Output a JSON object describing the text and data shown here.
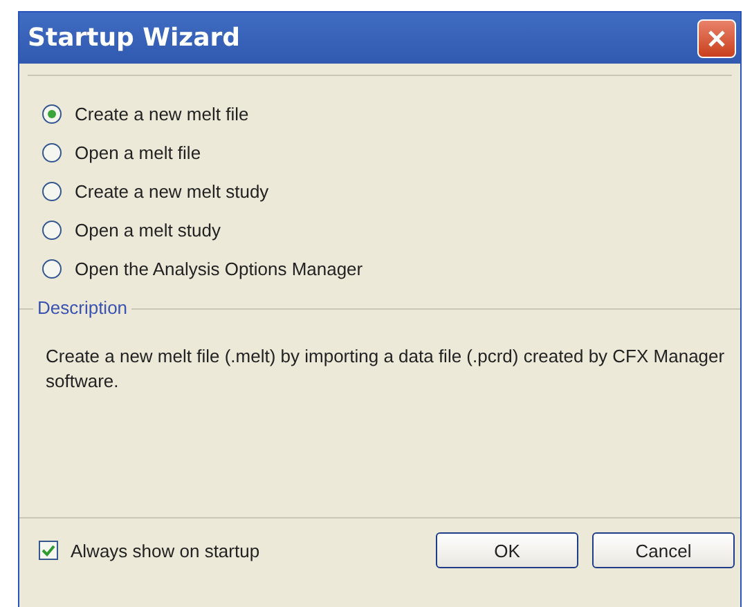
{
  "window": {
    "title": "Startup Wizard"
  },
  "options": [
    {
      "label": "Create a new melt file",
      "selected": true
    },
    {
      "label": "Open a melt file",
      "selected": false
    },
    {
      "label": "Create a new melt study",
      "selected": false
    },
    {
      "label": "Open a melt study",
      "selected": false
    },
    {
      "label": "Open the Analysis Options Manager",
      "selected": false
    }
  ],
  "description": {
    "legend": "Description",
    "text": "Create a new melt file (.melt) by importing a data file (.pcrd) created by CFX Manager software."
  },
  "always_show": {
    "label": "Always show on startup",
    "checked": true
  },
  "buttons": [
    "OK",
    "Cancel"
  ]
}
